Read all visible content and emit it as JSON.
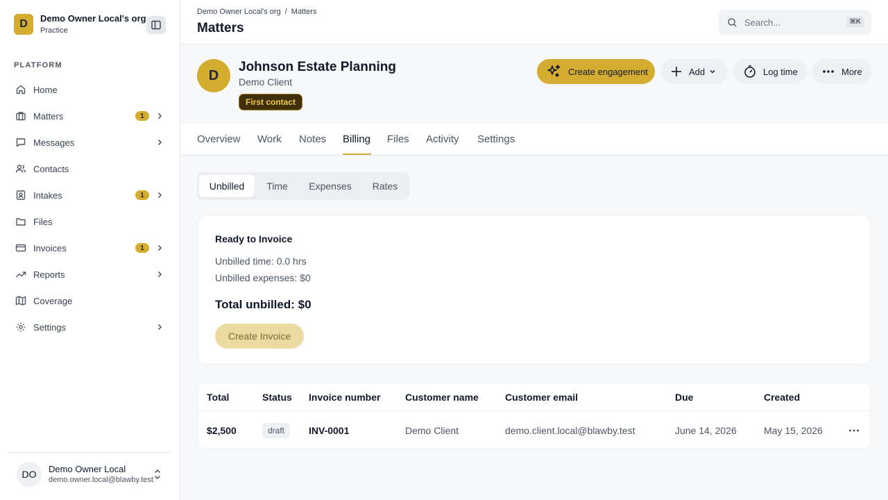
{
  "org": {
    "avatar": "D",
    "name": "Demo Owner Local's org",
    "subtitle": "Practice"
  },
  "sidebar": {
    "section_label": "PLATFORM",
    "items": [
      {
        "label": "Home",
        "icon": "home-icon",
        "badge": "",
        "chevron": false
      },
      {
        "label": "Matters",
        "icon": "briefcase-icon",
        "badge": "1",
        "chevron": true
      },
      {
        "label": "Messages",
        "icon": "message-icon",
        "badge": "",
        "chevron": true
      },
      {
        "label": "Contacts",
        "icon": "users-icon",
        "badge": "",
        "chevron": false
      },
      {
        "label": "Intakes",
        "icon": "contact-card-icon",
        "badge": "1",
        "chevron": true
      },
      {
        "label": "Files",
        "icon": "folder-icon",
        "badge": "",
        "chevron": false
      },
      {
        "label": "Invoices",
        "icon": "credit-card-icon",
        "badge": "1",
        "chevron": true
      },
      {
        "label": "Reports",
        "icon": "trending-up-icon",
        "badge": "",
        "chevron": true
      },
      {
        "label": "Coverage",
        "icon": "map-icon",
        "badge": "",
        "chevron": false
      },
      {
        "label": "Settings",
        "icon": "gear-icon",
        "badge": "",
        "chevron": true
      }
    ]
  },
  "user": {
    "initials": "DO",
    "name": "Demo Owner Local",
    "email": "demo.owner.local@blawby.test"
  },
  "header": {
    "breadcrumb": [
      "Demo Owner Local's org",
      "/",
      "Matters"
    ],
    "title": "Matters",
    "search_placeholder": "Search...",
    "search_shortcut": "⌘K"
  },
  "matter": {
    "avatar": "D",
    "title": "Johnson Estate Planning",
    "client": "Demo Client",
    "status": "First contact",
    "actions": {
      "engage": "Create engagement",
      "add": "Add",
      "log_time": "Log time",
      "more": "More"
    }
  },
  "tabs": [
    "Overview",
    "Work",
    "Notes",
    "Billing",
    "Files",
    "Activity",
    "Settings"
  ],
  "active_tab": "Billing",
  "subtabs": [
    "Unbilled",
    "Time",
    "Expenses",
    "Rates"
  ],
  "active_subtab": "Unbilled",
  "invoice_card": {
    "title": "Ready to Invoice",
    "unbilled_time": "Unbilled time: 0.0 hrs",
    "unbilled_expenses": "Unbilled expenses: $0",
    "total": "Total unbilled: $0",
    "button": "Create Invoice"
  },
  "invoices_table": {
    "columns": [
      "Total",
      "Status",
      "Invoice number",
      "Customer name",
      "Customer email",
      "Due",
      "Created"
    ],
    "rows": [
      {
        "total": "$2,500",
        "status": "draft",
        "number": "INV-0001",
        "customer": "Demo Client",
        "email": "demo.client.local@blawby.test",
        "due": "June 14, 2026",
        "created": "May 15, 2026"
      }
    ]
  },
  "colors": {
    "accent": "#d4ac2f",
    "status_pill_bg": "#3f2f0a",
    "status_pill_text": "#f3c845"
  }
}
